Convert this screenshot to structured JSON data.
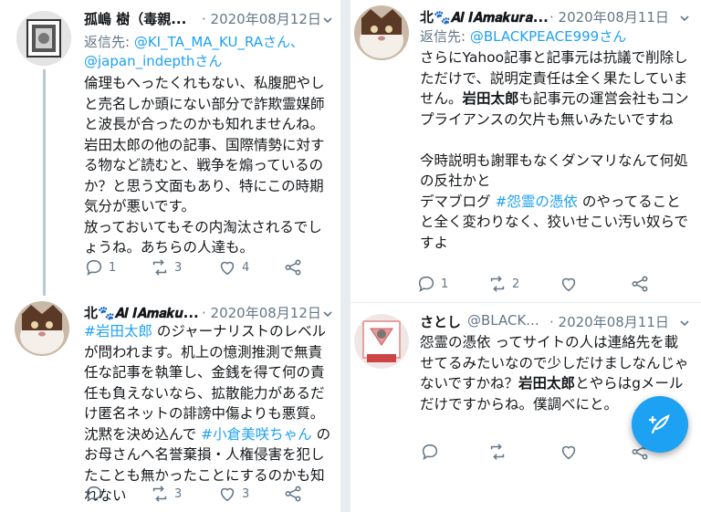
{
  "left": {
    "tweets": [
      {
        "name": "孤嶋 樹（毒親...",
        "date": "2020年08月12日",
        "reply_prefix": "返信先: ",
        "reply_to_1": "@KI_TA_MA_KU_RAさん、",
        "reply_to_2": "@japan_indepthさん",
        "body": "倫理もへったくれもない、私腹肥やしと売名しか頭にない部分で詐欺霊媒師と波長が合ったのかも知れませんね。\n岩田太郎の他の記事、国際情勢に対する物など読むと、戦争を煽っているのか？と思う文面もあり、特にこの時期気分が悪いです。\n放っておいてもその内淘汰されるでしょうね。あちらの人達も。",
        "replies": "1",
        "retweets": "3",
        "likes": "4"
      },
      {
        "name": "北🐾𝑨𝒍 𝑰𝑨𝒎𝒂𝒌𝒖...",
        "date": "2020年08月12日",
        "body_hashtag_1": "#岩田太郎",
        "body_part_1": " のジャーナリストのレベルが問われます。机上の憶測推測で無責任な記事を執筆し、金銭を得て何の責任も負えないなら、拡散能力があるだけ匿名ネットの誹謗中傷よりも悪質。沈黙を決め込んで ",
        "body_hashtag_2": "#小倉美咲ちゃん",
        "body_part_2": " のお母さんへ名誉棄損・人権侵害を犯したことも無かったことにするのかも知れない",
        "replies": "",
        "retweets": "3",
        "likes": "3"
      }
    ]
  },
  "right": {
    "tweets": [
      {
        "name": "北🐾𝑨𝒍 𝑰𝑨𝒎𝒂𝒌𝒖𝒓𝒂...",
        "date": "2020年08月11日",
        "reply_prefix": "返信先: ",
        "reply_to_1": "@BLACKPEACE999さん",
        "body_part_1": "さらにYahoo記事と記事元は抗議で削除しただけで、説明定責任は全く果たしていません。",
        "body_bold_1": "岩田太郎",
        "body_part_2": "も記事元の運営会社もコンプライアンスの欠片も無いみたいですね\n\n今時説明も謝罪もなくダンマリなんて何処の反社かと\nデマブログ ",
        "body_hashtag_1": "#怨霊の憑依",
        "body_part_3": " のやってることと全く変わりなく、狡いせこい汚い奴らですよ",
        "replies": "1",
        "retweets": "2",
        "likes": ""
      },
      {
        "name": "さとし",
        "handle": "@BLACK...",
        "date": "2020年08月11日",
        "body_part_1": "怨霊の憑依 ってサイトの人は連絡先を載せてるみたいなので少しだけましなんじゃないですかね？",
        "body_bold_1": "岩田太郎",
        "body_part_2": "とやらはgメールだけですからね。僕調べにと。",
        "replies": "",
        "retweets": "",
        "likes": ""
      }
    ]
  },
  "fab": {
    "icon": "compose-feather-icon"
  },
  "colors": {
    "accent": "#1da1f2",
    "muted": "#657786",
    "text": "#14171a",
    "thread": "#b9c8d6"
  }
}
